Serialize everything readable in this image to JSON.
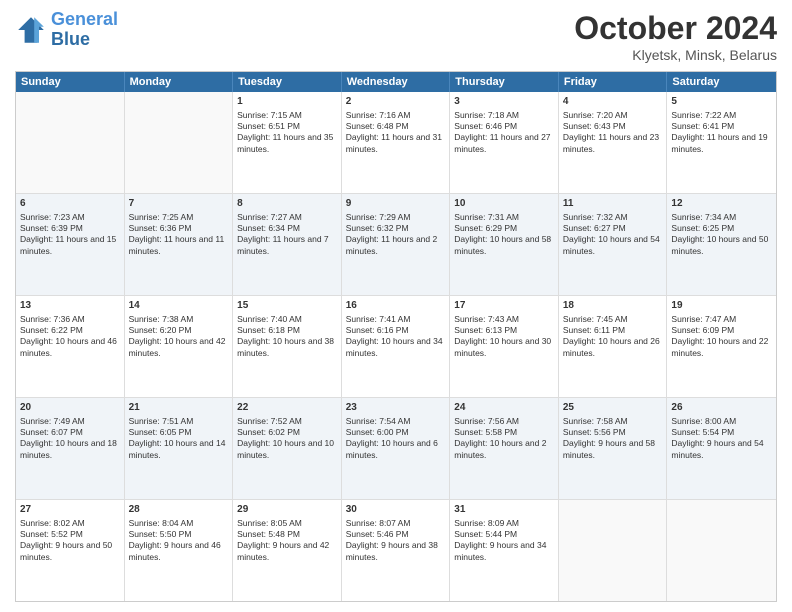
{
  "header": {
    "logo_line1": "General",
    "logo_line2": "Blue",
    "title": "October 2024",
    "subtitle": "Klyetsk, Minsk, Belarus"
  },
  "days": [
    "Sunday",
    "Monday",
    "Tuesday",
    "Wednesday",
    "Thursday",
    "Friday",
    "Saturday"
  ],
  "weeks": [
    [
      {
        "day": "",
        "content": ""
      },
      {
        "day": "",
        "content": ""
      },
      {
        "day": "1",
        "content": "Sunrise: 7:15 AM\nSunset: 6:51 PM\nDaylight: 11 hours and 35 minutes."
      },
      {
        "day": "2",
        "content": "Sunrise: 7:16 AM\nSunset: 6:48 PM\nDaylight: 11 hours and 31 minutes."
      },
      {
        "day": "3",
        "content": "Sunrise: 7:18 AM\nSunset: 6:46 PM\nDaylight: 11 hours and 27 minutes."
      },
      {
        "day": "4",
        "content": "Sunrise: 7:20 AM\nSunset: 6:43 PM\nDaylight: 11 hours and 23 minutes."
      },
      {
        "day": "5",
        "content": "Sunrise: 7:22 AM\nSunset: 6:41 PM\nDaylight: 11 hours and 19 minutes."
      }
    ],
    [
      {
        "day": "6",
        "content": "Sunrise: 7:23 AM\nSunset: 6:39 PM\nDaylight: 11 hours and 15 minutes."
      },
      {
        "day": "7",
        "content": "Sunrise: 7:25 AM\nSunset: 6:36 PM\nDaylight: 11 hours and 11 minutes."
      },
      {
        "day": "8",
        "content": "Sunrise: 7:27 AM\nSunset: 6:34 PM\nDaylight: 11 hours and 7 minutes."
      },
      {
        "day": "9",
        "content": "Sunrise: 7:29 AM\nSunset: 6:32 PM\nDaylight: 11 hours and 2 minutes."
      },
      {
        "day": "10",
        "content": "Sunrise: 7:31 AM\nSunset: 6:29 PM\nDaylight: 10 hours and 58 minutes."
      },
      {
        "day": "11",
        "content": "Sunrise: 7:32 AM\nSunset: 6:27 PM\nDaylight: 10 hours and 54 minutes."
      },
      {
        "day": "12",
        "content": "Sunrise: 7:34 AM\nSunset: 6:25 PM\nDaylight: 10 hours and 50 minutes."
      }
    ],
    [
      {
        "day": "13",
        "content": "Sunrise: 7:36 AM\nSunset: 6:22 PM\nDaylight: 10 hours and 46 minutes."
      },
      {
        "day": "14",
        "content": "Sunrise: 7:38 AM\nSunset: 6:20 PM\nDaylight: 10 hours and 42 minutes."
      },
      {
        "day": "15",
        "content": "Sunrise: 7:40 AM\nSunset: 6:18 PM\nDaylight: 10 hours and 38 minutes."
      },
      {
        "day": "16",
        "content": "Sunrise: 7:41 AM\nSunset: 6:16 PM\nDaylight: 10 hours and 34 minutes."
      },
      {
        "day": "17",
        "content": "Sunrise: 7:43 AM\nSunset: 6:13 PM\nDaylight: 10 hours and 30 minutes."
      },
      {
        "day": "18",
        "content": "Sunrise: 7:45 AM\nSunset: 6:11 PM\nDaylight: 10 hours and 26 minutes."
      },
      {
        "day": "19",
        "content": "Sunrise: 7:47 AM\nSunset: 6:09 PM\nDaylight: 10 hours and 22 minutes."
      }
    ],
    [
      {
        "day": "20",
        "content": "Sunrise: 7:49 AM\nSunset: 6:07 PM\nDaylight: 10 hours and 18 minutes."
      },
      {
        "day": "21",
        "content": "Sunrise: 7:51 AM\nSunset: 6:05 PM\nDaylight: 10 hours and 14 minutes."
      },
      {
        "day": "22",
        "content": "Sunrise: 7:52 AM\nSunset: 6:02 PM\nDaylight: 10 hours and 10 minutes."
      },
      {
        "day": "23",
        "content": "Sunrise: 7:54 AM\nSunset: 6:00 PM\nDaylight: 10 hours and 6 minutes."
      },
      {
        "day": "24",
        "content": "Sunrise: 7:56 AM\nSunset: 5:58 PM\nDaylight: 10 hours and 2 minutes."
      },
      {
        "day": "25",
        "content": "Sunrise: 7:58 AM\nSunset: 5:56 PM\nDaylight: 9 hours and 58 minutes."
      },
      {
        "day": "26",
        "content": "Sunrise: 8:00 AM\nSunset: 5:54 PM\nDaylight: 9 hours and 54 minutes."
      }
    ],
    [
      {
        "day": "27",
        "content": "Sunrise: 8:02 AM\nSunset: 5:52 PM\nDaylight: 9 hours and 50 minutes."
      },
      {
        "day": "28",
        "content": "Sunrise: 8:04 AM\nSunset: 5:50 PM\nDaylight: 9 hours and 46 minutes."
      },
      {
        "day": "29",
        "content": "Sunrise: 8:05 AM\nSunset: 5:48 PM\nDaylight: 9 hours and 42 minutes."
      },
      {
        "day": "30",
        "content": "Sunrise: 8:07 AM\nSunset: 5:46 PM\nDaylight: 9 hours and 38 minutes."
      },
      {
        "day": "31",
        "content": "Sunrise: 8:09 AM\nSunset: 5:44 PM\nDaylight: 9 hours and 34 minutes."
      },
      {
        "day": "",
        "content": ""
      },
      {
        "day": "",
        "content": ""
      }
    ]
  ]
}
